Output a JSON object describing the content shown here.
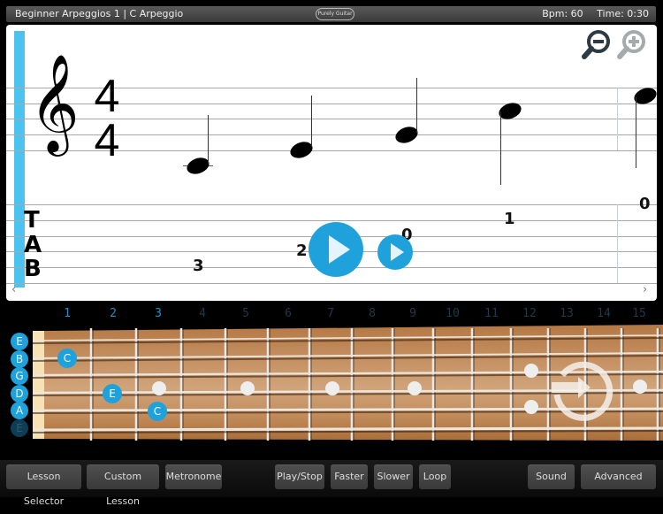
{
  "titlebar": {
    "title": "Beginner Arpeggios 1 | C Arpeggio",
    "logo": "Purely Guitar",
    "bpm": "Bpm: 60",
    "time": "Time: 0:30"
  },
  "score": {
    "time_signature": {
      "top": "4",
      "bottom": "4"
    },
    "clef": "treble-clef",
    "tab_label": [
      "T",
      "A",
      "B"
    ],
    "tab_numbers": [
      "3",
      "2",
      "0",
      "1",
      "0"
    ],
    "zoom_out_icon": "zoom-out-icon",
    "zoom_in_icon": "zoom-in-icon",
    "scroll_left": "‹",
    "scroll_right": "›",
    "clef_glyph": "𝄞"
  },
  "fretboard": {
    "fret_numbers": [
      "1",
      "2",
      "3",
      "4",
      "5",
      "6",
      "7",
      "8",
      "9",
      "10",
      "11",
      "12",
      "13",
      "14",
      "15"
    ],
    "active_frets": [
      "1",
      "2",
      "3"
    ],
    "strings": [
      "E",
      "B",
      "G",
      "D",
      "A",
      "E"
    ],
    "notes": [
      {
        "label": "C",
        "string": "B",
        "fret": 1
      },
      {
        "label": "E",
        "string": "D",
        "fret": 2
      },
      {
        "label": "C",
        "string": "A",
        "fret": 3
      }
    ],
    "loop_icon": "loop-icon"
  },
  "toolbar": {
    "lesson_selector": "Lesson Selector",
    "custom_lesson": "Custom Lesson",
    "metronome": "Metronome",
    "play_stop": "Play/Stop",
    "faster": "Faster",
    "slower": "Slower",
    "loop": "Loop",
    "sound": "Sound",
    "advanced": "Advanced"
  }
}
